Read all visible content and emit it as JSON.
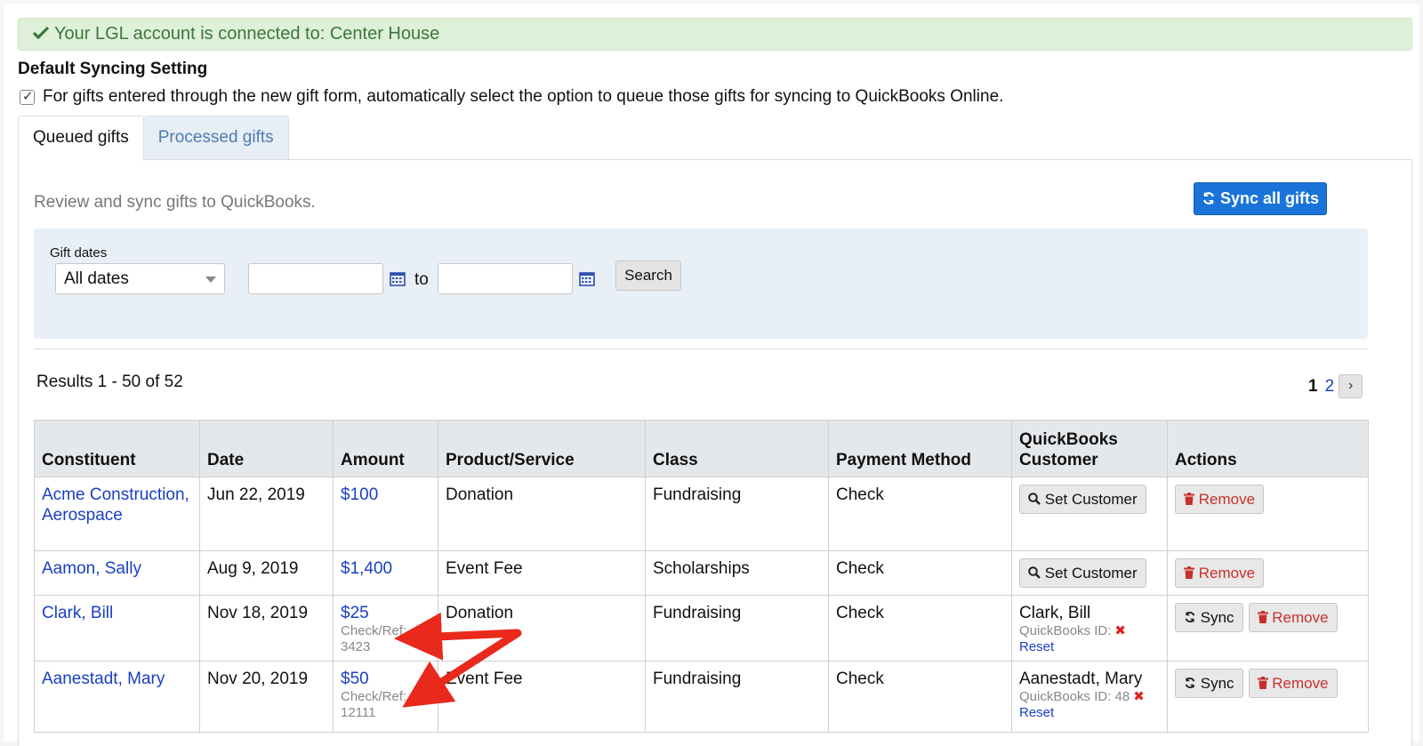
{
  "alert": {
    "icon": "check-icon",
    "text": "Your LGL account is connected to: Center House"
  },
  "settings": {
    "title": "Default Syncing Setting",
    "checkbox_checked": true,
    "checkbox_label": "For gifts entered through the new gift form, automatically select the option to queue those gifts for syncing to QuickBooks Online."
  },
  "tabs": [
    {
      "label": "Queued gifts",
      "active": true
    },
    {
      "label": "Processed gifts",
      "active": false
    }
  ],
  "panel": {
    "description": "Review and sync gifts to QuickBooks.",
    "sync_all_label": "Sync all gifts"
  },
  "filter": {
    "label": "Gift dates",
    "date_select_value": "All dates",
    "from_value": "",
    "to_label": "to",
    "to_value": "",
    "search_label": "Search"
  },
  "results": {
    "summary": "Results 1 - 50 of 52",
    "pages": [
      "1",
      "2"
    ],
    "current_page": "1",
    "next_label": "›"
  },
  "table": {
    "headers": [
      "Constituent",
      "Date",
      "Amount",
      "Product/Service",
      "Class",
      "Payment Method",
      "QuickBooks Customer",
      "Actions"
    ],
    "rows": [
      {
        "constituent": "Acme Construction, Aerospace",
        "date": "Jun 22, 2019",
        "amount": "$100",
        "check_ref_label": "",
        "check_ref": "",
        "product": "Donation",
        "class": "Fundraising",
        "payment": "Check",
        "qb_customer": "",
        "qb_id_label": "",
        "reset_label": "",
        "set_customer_label": "Set Customer",
        "sync_label": "",
        "remove_label": "Remove"
      },
      {
        "constituent": "Aamon, Sally",
        "date": "Aug 9, 2019",
        "amount": "$1,400",
        "check_ref_label": "",
        "check_ref": "",
        "product": "Event Fee",
        "class": "Scholarships",
        "payment": "Check",
        "qb_customer": "",
        "qb_id_label": "",
        "reset_label": "",
        "set_customer_label": "Set Customer",
        "sync_label": "",
        "remove_label": "Remove"
      },
      {
        "constituent": "Clark, Bill",
        "date": "Nov 18, 2019",
        "amount": "$25",
        "check_ref_label": "Check/Ref:",
        "check_ref": "3423",
        "product": "Donation",
        "class": "Fundraising",
        "payment": "Check",
        "qb_customer": "Clark, Bill",
        "qb_id_label": "QuickBooks ID:",
        "reset_label": "Reset",
        "set_customer_label": "",
        "sync_label": "Sync",
        "remove_label": "Remove"
      },
      {
        "constituent": "Aanestadt, Mary",
        "date": "Nov 20, 2019",
        "amount": "$50",
        "check_ref_label": "Check/Ref:",
        "check_ref": "12111",
        "product": "Event Fee",
        "class": "Fundraising",
        "payment": "Check",
        "qb_customer": "Aanestadt, Mary",
        "qb_id_label": "QuickBooks ID: 48",
        "reset_label": "Reset",
        "set_customer_label": "",
        "sync_label": "Sync",
        "remove_label": "Remove"
      }
    ]
  },
  "colors": {
    "alert_bg": "#dff0d8",
    "alert_text": "#3c763d",
    "primary": "#1a73d9",
    "link": "#1a3fc4",
    "danger": "#c9302c",
    "annotation_arrow": "#e8291c"
  }
}
